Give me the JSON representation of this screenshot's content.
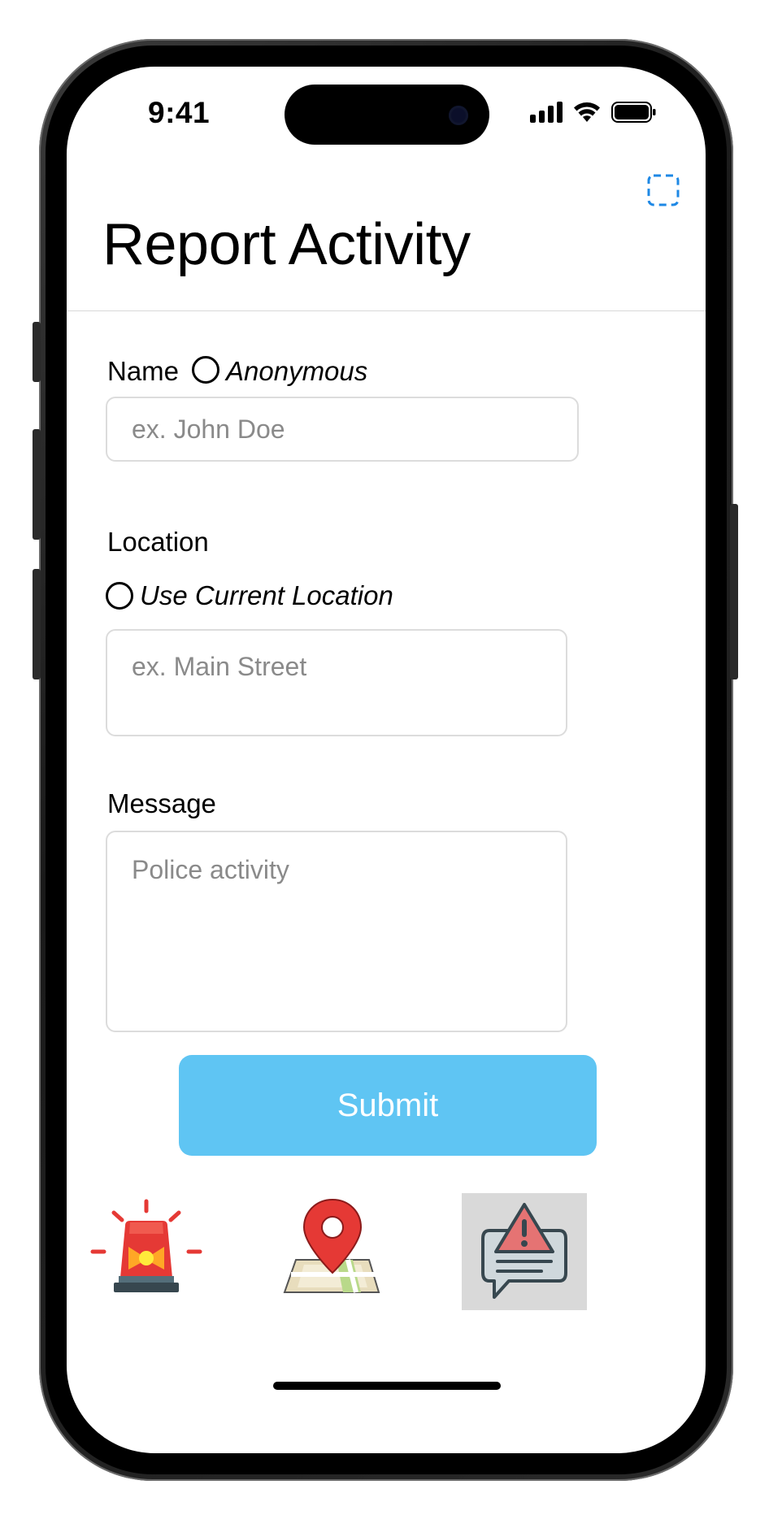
{
  "status_bar": {
    "time": "9:41"
  },
  "header": {
    "title": "Report Activity"
  },
  "form": {
    "name_label": "Name",
    "anonymous_label": "Anonymous",
    "name_placeholder": "ex. John Doe",
    "location_label": "Location",
    "use_current_location_label": "Use Current Location",
    "location_placeholder": "ex. Main Street",
    "message_label": "Message",
    "message_placeholder": "Police activity",
    "submit_label": "Submit"
  },
  "bottom_icons": [
    "siren-icon",
    "map-pin-icon",
    "alert-message-icon"
  ],
  "colors": {
    "accent": "#5fc5f3",
    "scan_icon": "#1e88e5",
    "siren_red": "#e53935",
    "pin_red": "#e53935"
  }
}
